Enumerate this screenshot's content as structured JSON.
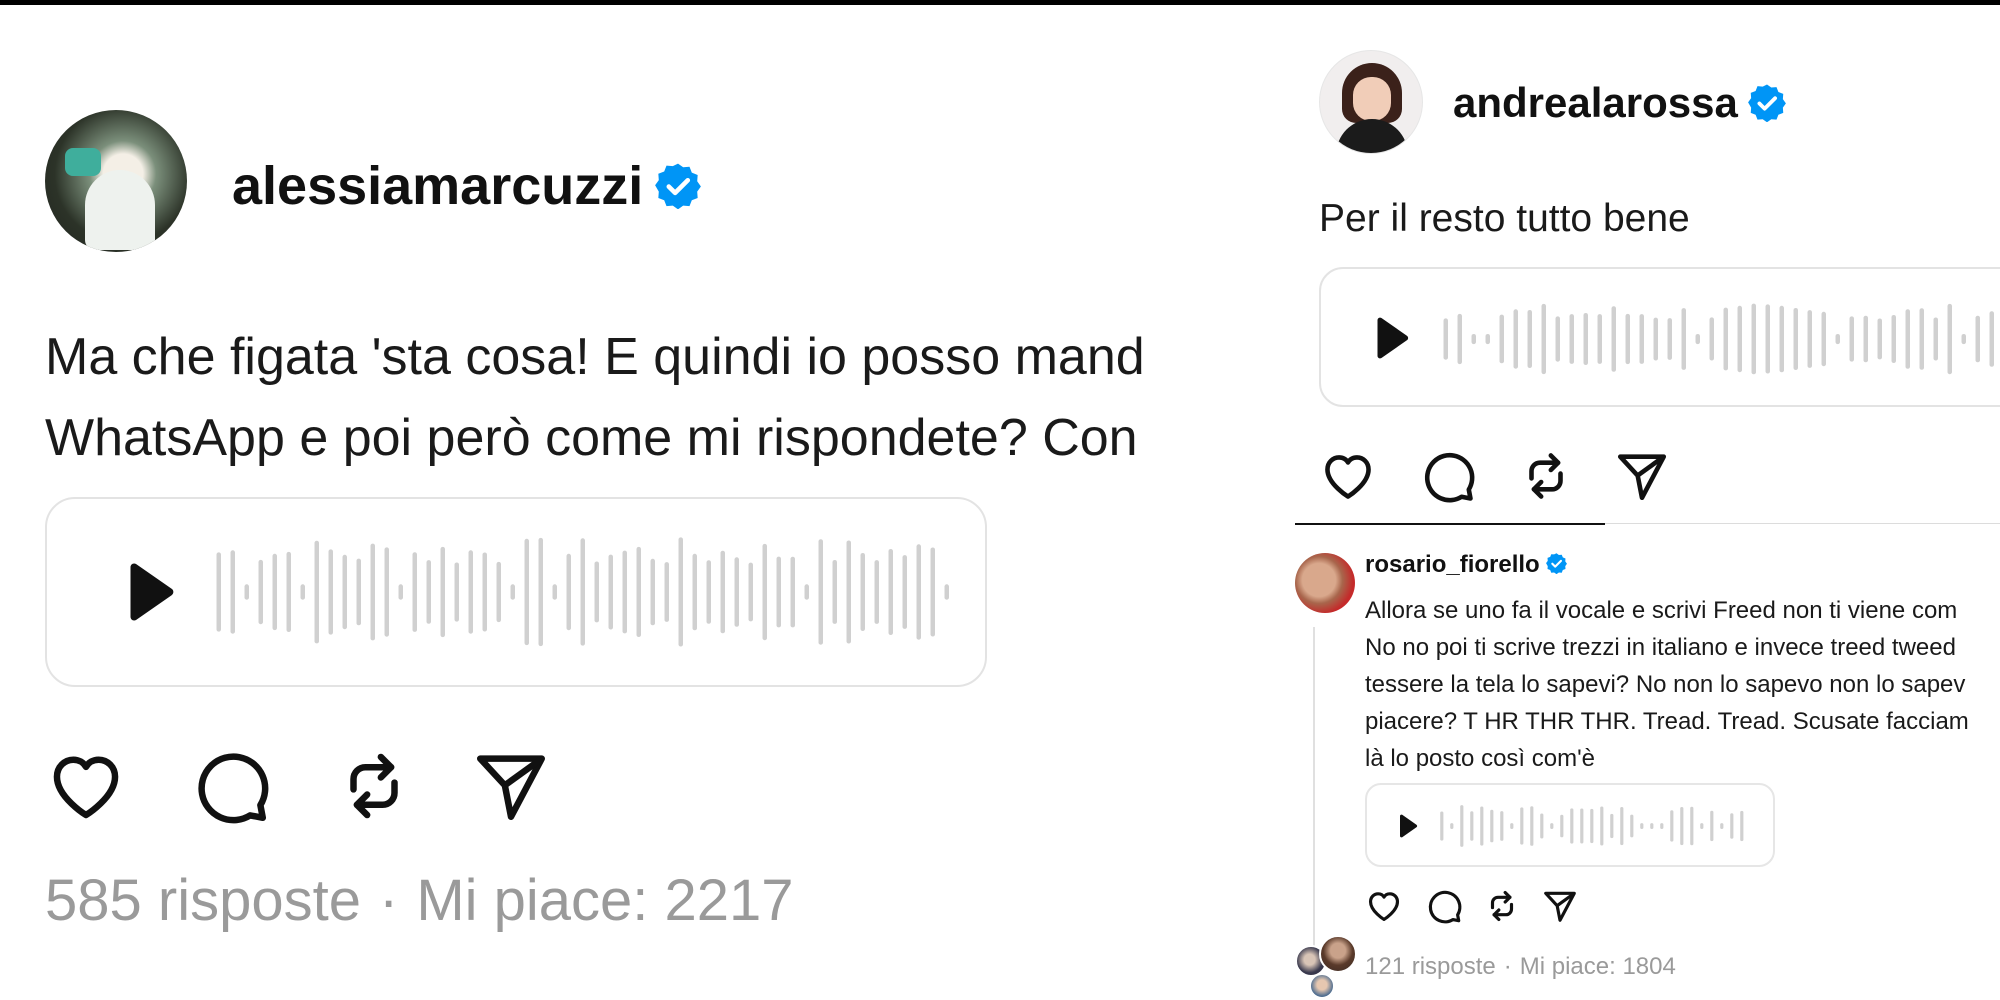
{
  "left_post": {
    "username": "alessiamarcuzzi",
    "verified_icon": "verified-badge-icon",
    "text_lines": [
      "Ma che figata 'sta cosa! E quindi io posso mand",
      "WhatsApp e poi però come mi rispondete? Con"
    ],
    "audio": {
      "play_icon": "play-icon"
    },
    "actions": [
      "heart-icon",
      "comment-icon",
      "repost-icon",
      "share-icon"
    ],
    "replies": "585 risposte",
    "separator": "·",
    "likes": "Mi piace: 2217"
  },
  "right_post": {
    "username": "andrealarossa",
    "verified_icon": "verified-badge-icon",
    "text": "Per il resto tutto bene",
    "audio": {
      "play_icon": "play-icon"
    },
    "actions": [
      "heart-icon",
      "comment-icon",
      "repost-icon",
      "share-icon"
    ]
  },
  "comment": {
    "username": "rosario_fiorello",
    "verified_icon": "verified-badge-icon",
    "text_lines": [
      "Allora se uno fa il vocale e scrivi Freed non ti viene com",
      "No no poi ti scrive trezzi in italiano e invece treed tweed",
      "tessere la tela lo sapevi? No non lo sapevo non lo sapev",
      "piacere? T HR THR THR. Tread. Tread. Scusate facciam",
      "là lo posto così com'è"
    ],
    "audio": {
      "play_icon": "play-icon"
    },
    "actions": [
      "heart-icon",
      "comment-icon",
      "repost-icon",
      "share-icon"
    ],
    "replies": "121 risposte",
    "separator": "·",
    "likes": "Mi piace: 1804"
  },
  "colors": {
    "verified": "#0095f6",
    "waveform": "#d0d0d0",
    "muted_text": "#9a9a9a",
    "border": "#e3e3e3"
  }
}
